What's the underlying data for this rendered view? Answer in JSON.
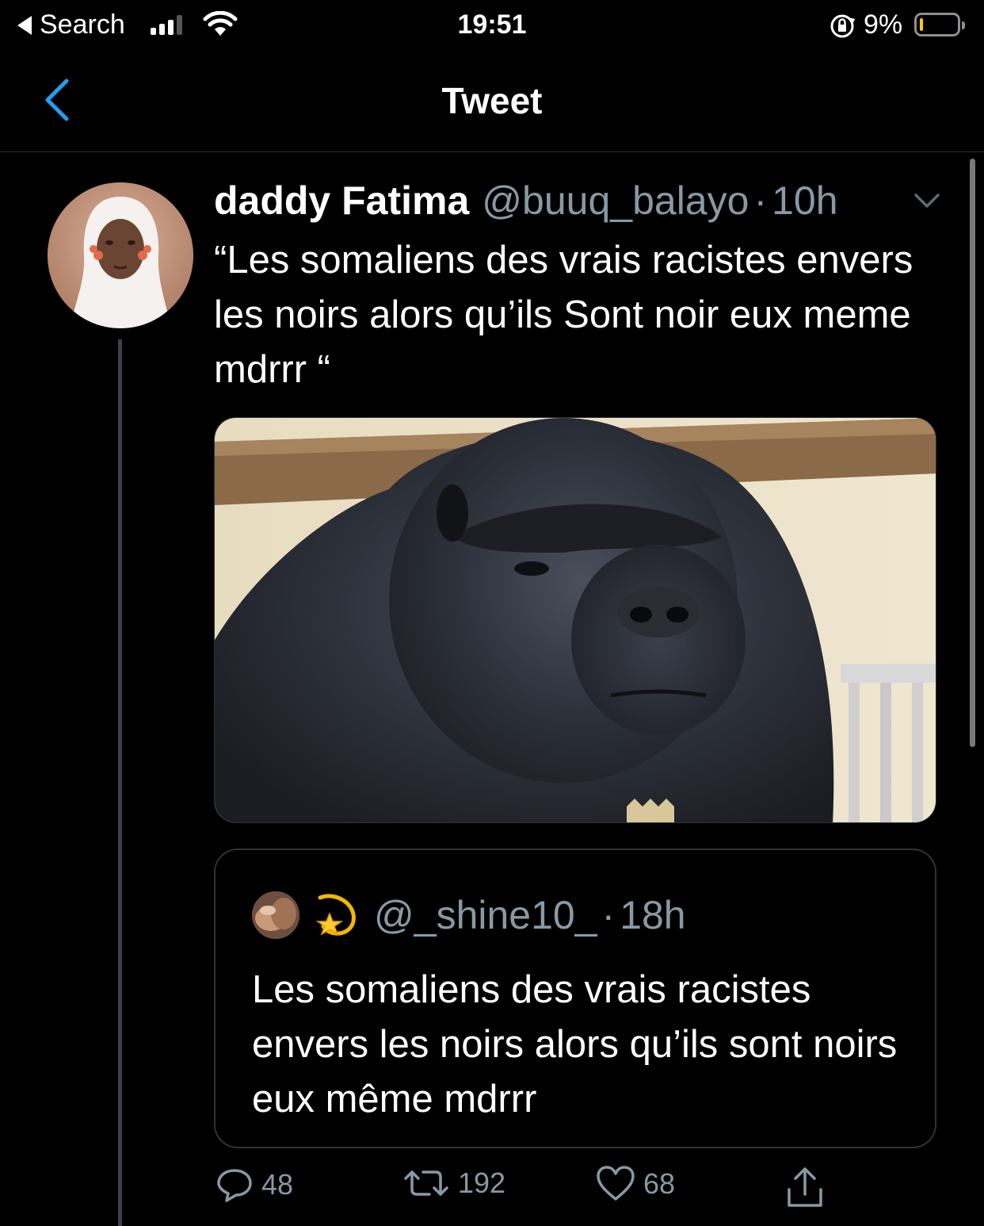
{
  "status_bar": {
    "back_app": "Search",
    "time": "19:51",
    "battery_percent": "9%",
    "battery_level": 0.09,
    "battery_color": "#ffcc00"
  },
  "nav": {
    "title": "Tweet",
    "back_icon": "chevron-left-icon",
    "accent_color": "#1da1f2"
  },
  "tweet": {
    "display_name": "daddy Fatima",
    "handle": "@buuq_balayo",
    "separator": "·",
    "time": "10h",
    "text": "“Les somaliens des vrais racistes envers les noirs alors qu’ils Sont noir eux meme mdrrr “",
    "media_icon": "gorilla-photo",
    "quoted": {
      "handle": "@_shine10_",
      "separator": "·",
      "time": "18h",
      "emoji_icon": "dizzy-star-icon",
      "text": "Les somaliens des vrais racistes envers les noirs alors qu’ils sont noirs eux même mdrrr"
    },
    "actions": {
      "reply_count": "48",
      "retweet_count": "192",
      "like_count": "68"
    }
  }
}
